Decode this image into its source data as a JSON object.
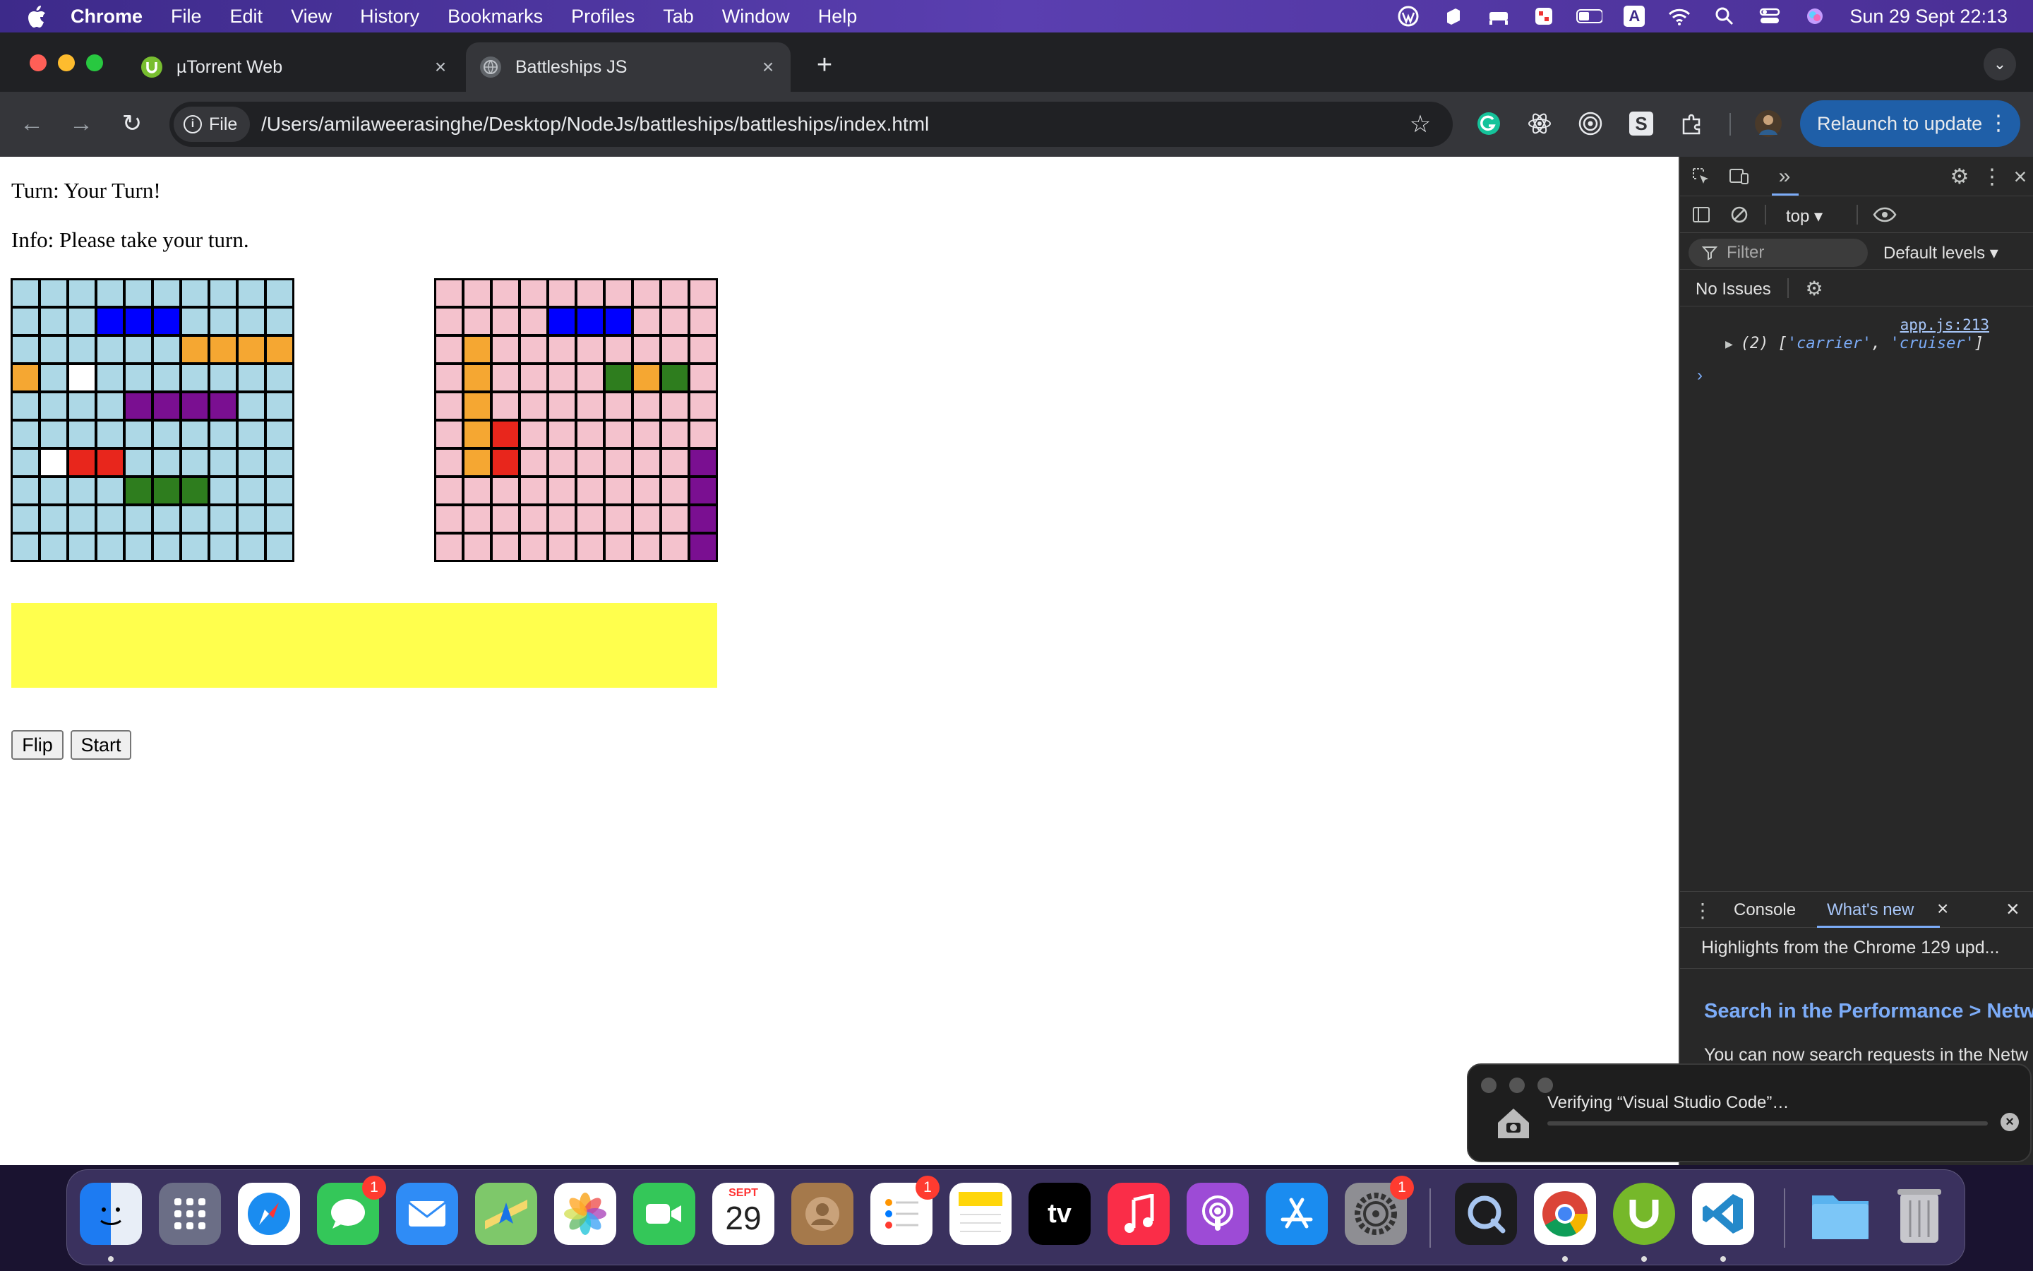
{
  "menubar": {
    "items": [
      "Chrome",
      "File",
      "Edit",
      "View",
      "History",
      "Bookmarks",
      "Profiles",
      "Tab",
      "Window",
      "Help"
    ],
    "clock": "Sun 29 Sept  22:13",
    "input_source": "A"
  },
  "browser": {
    "tabs": [
      {
        "title": "µTorrent Web",
        "active": false
      },
      {
        "title": "Battleships JS",
        "active": true
      }
    ],
    "file_chip": "File",
    "url": "/Users/amilaweerasinghe/Desktop/NodeJs/battleships/battleships/index.html",
    "relaunch_label": "Relaunch to update",
    "extension_s": "S"
  },
  "page": {
    "turn_text": "Turn: Your Turn!",
    "info_text": "Info: Please take your turn.",
    "buttons": {
      "flip": "Flip",
      "start": "Start"
    }
  },
  "colors": {
    "player_water": "#add8e6",
    "computer_water": "#f4c2cd",
    "destroyer": "#f5a732",
    "submarine": "#0000ff",
    "cruiser": "#2e7d1e",
    "battleship": "#7a0f91",
    "carrier": "#f0a030",
    "hit": "#e8261c",
    "miss": "#ffffff",
    "dock_yellow": "#ffff4d"
  },
  "boards": {
    "player": [
      "WWWWWWWWWW",
      "WWWBBBWWWW",
      "WWWWWWOOOO",
      "OWMWWWWWWW",
      "WWWWPPPPWW",
      "WWWWWWWWWW",
      "WMHHWWWWWW",
      "WWWWGGGWWW",
      "WWWWWWWWWW",
      "WWWWWWWWWW"
    ],
    "computer": [
      "WWWWWWWWWW",
      "WWWWBBBWWW",
      "WOWWWWWWWW",
      "WOWWWWGOGW",
      "WOWWWWWWWW",
      "WOHWWWWWWW",
      "WOHWWWWWWP",
      "WWWWWWWWWP",
      "WWWWWWWWWP",
      "WWWWWWWWWP"
    ]
  },
  "devtools": {
    "context": "top ▾",
    "filter_placeholder": "Filter",
    "levels": "Default levels ▾",
    "issues": "No Issues",
    "log_source": "app.js:213",
    "log_count": "(2)",
    "log_items": [
      "'carrier'",
      "'cruiser'"
    ],
    "drawer_tabs": [
      "Console",
      "What's new"
    ],
    "highlights": "Highlights from the Chrome 129 upd...",
    "whats_new_title": "Search in the Performance > Netw",
    "whats_new_body": "You can now search requests in the Netw"
  },
  "notification": {
    "text": "Verifying “Visual Studio Code”…"
  },
  "dock": {
    "calendar_month": "SEPT",
    "calendar_day": "29",
    "messages_badge": "1",
    "reminders_badge": "1",
    "settings_badge": "1",
    "tv_label": "tv"
  }
}
